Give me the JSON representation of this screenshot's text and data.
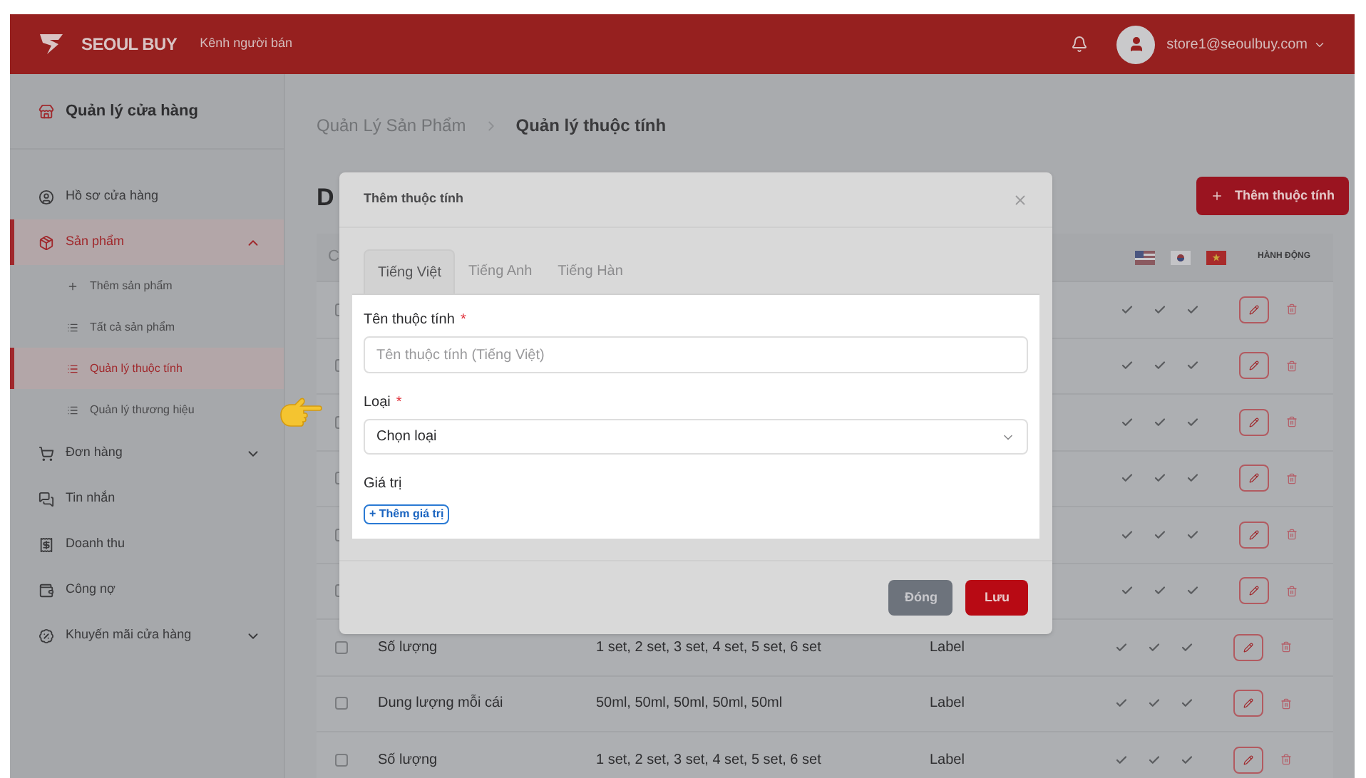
{
  "header": {
    "brand": "SEOUL BUY",
    "subtitle": "Kênh người bán",
    "user_email": "store1@seoulbuy.com"
  },
  "sidebar": {
    "title": "Quản lý cửa hàng",
    "items": [
      {
        "kind": "profile",
        "label": "Hồ sơ cửa hàng",
        "selected": false
      },
      {
        "kind": "product",
        "label": "Sản phẩm",
        "selected": true,
        "expanded": true,
        "children": [
          {
            "kind": "add",
            "label": "Thêm sản phẩm",
            "selected": false
          },
          {
            "kind": "list",
            "label": "Tất cả sản phẩm",
            "selected": false
          },
          {
            "kind": "list",
            "label": "Quản lý thuộc tính",
            "selected": true
          },
          {
            "kind": "list",
            "label": "Quản lý thương hiệu",
            "selected": false
          }
        ]
      },
      {
        "kind": "orders",
        "label": "Đơn hàng",
        "selected": false,
        "expanded": false
      },
      {
        "kind": "messages",
        "label": "Tin nhắn",
        "selected": false
      },
      {
        "kind": "revenue",
        "label": "Doanh thu",
        "selected": false
      },
      {
        "kind": "debt",
        "label": "Công nợ",
        "selected": false
      },
      {
        "kind": "promo",
        "label": "Khuyến mãi cửa hàng",
        "selected": false,
        "expanded": false
      }
    ]
  },
  "breadcrumb": [
    "Quản Lý Sản Phẩm",
    "Quản lý thuộc tính"
  ],
  "page_title": "D",
  "add_button": "Thêm thuộc tính",
  "table": {
    "column_1": "C",
    "action_header": "HÀNH ĐỘNG",
    "rows": [
      {
        "kind": "covered",
        "checked": false
      },
      {
        "kind": "covered",
        "checked": false
      },
      {
        "kind": "covered",
        "checked": false
      },
      {
        "kind": "covered",
        "checked": false
      },
      {
        "kind": "covered",
        "checked": false
      },
      {
        "kind": "covered",
        "checked": false
      },
      {
        "kind": "full",
        "checked": false,
        "name": "Số lượng",
        "values": "1 set, 2 set, 3 set, 4 set, 5 set, 6 set",
        "type": "Label"
      },
      {
        "kind": "full",
        "checked": false,
        "name": "Dung lượng mỗi cái",
        "values": "50ml, 50ml, 50ml, 50ml, 50ml",
        "type": "Label"
      },
      {
        "kind": "full",
        "checked": false,
        "name": "Số lượng",
        "values": "1 set, 2 set, 3 set, 4 set, 5 set, 6 set",
        "type": "Label"
      }
    ]
  },
  "modal": {
    "title": "Thêm thuộc tính",
    "tabs": [
      {
        "label": "Tiếng Việt",
        "selected": true
      },
      {
        "label": "Tiếng Anh",
        "selected": false
      },
      {
        "label": "Tiếng Hàn",
        "selected": false
      }
    ],
    "fields": [
      {
        "kind": "text",
        "label": "Tên thuộc tính",
        "required_mark": "*",
        "placeholder": "Tên thuộc tính (Tiếng Việt)"
      },
      {
        "kind": "select",
        "label": "Loại",
        "required_mark": "*",
        "value": "Chọn loại"
      },
      {
        "kind": "values",
        "label": "Giá trị",
        "add_label": "+ Thêm giá trị"
      }
    ],
    "close_button": "Đóng",
    "save_button": "Lưu"
  }
}
